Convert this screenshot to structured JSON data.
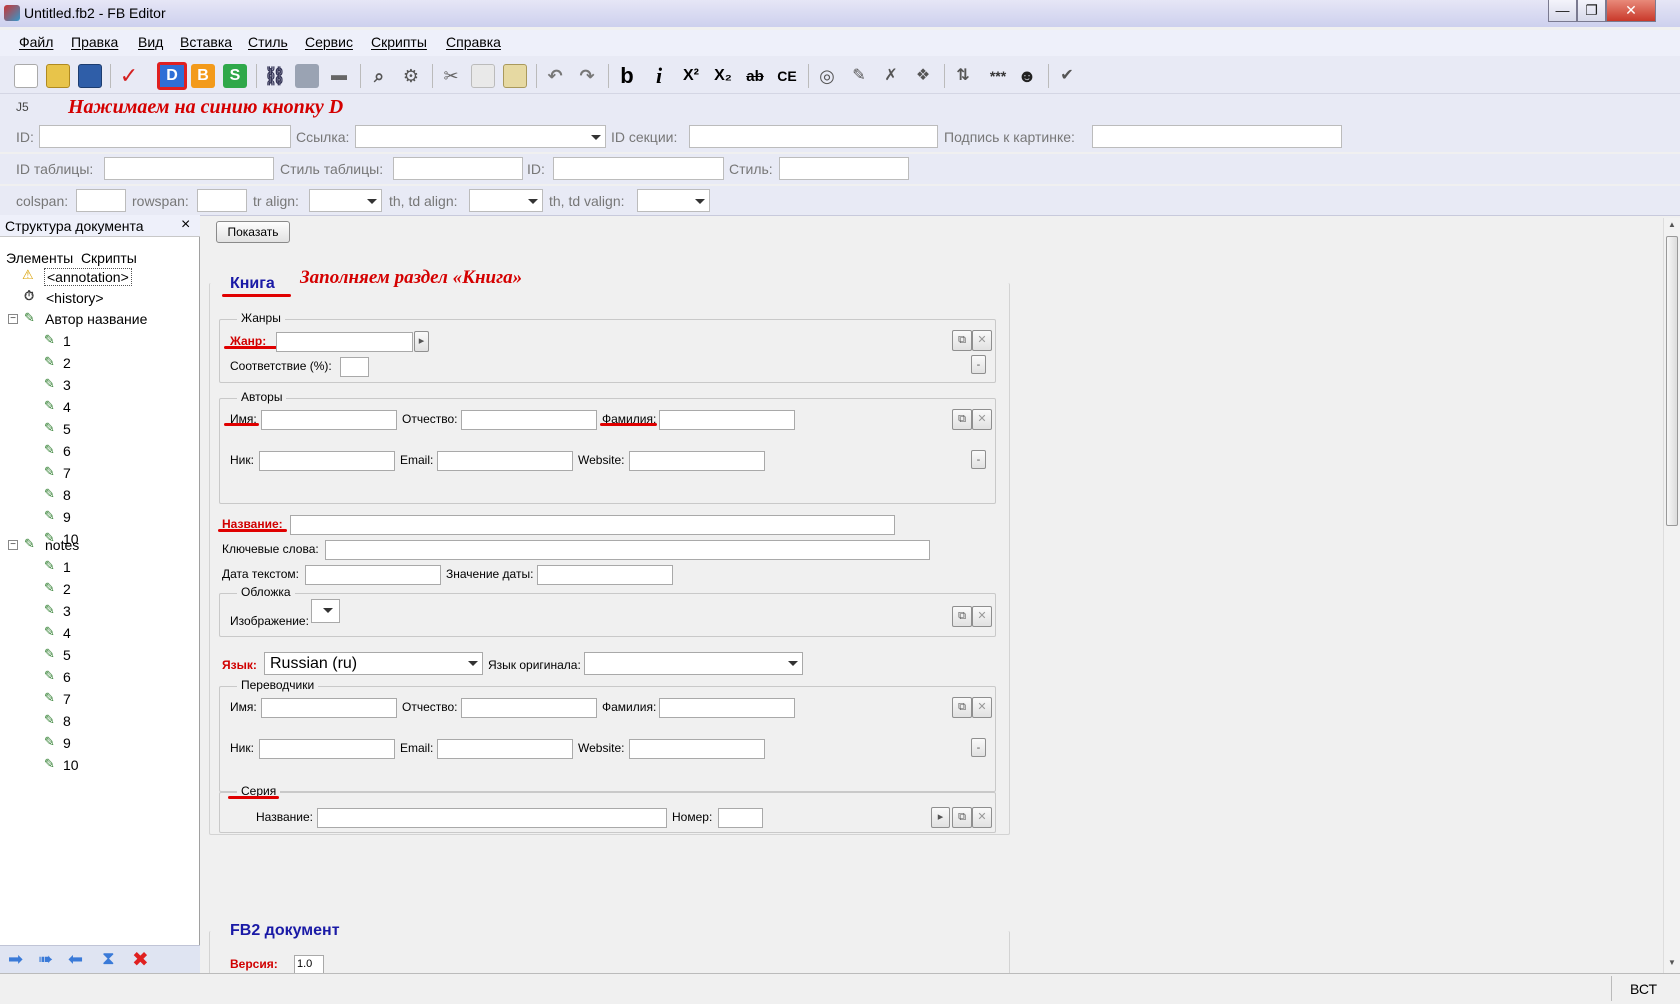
{
  "window": {
    "title": "Untitled.fb2 - FB Editor",
    "minimize": "—",
    "maximize": "❐",
    "close": "✕"
  },
  "menu": [
    "Файл",
    "Правка",
    "Вид",
    "Вставка",
    "Стиль",
    "Сервис",
    "Скрипты",
    "Справка"
  ],
  "toolbar": {
    "d_label": "D",
    "b_label": "B",
    "s_label": "S",
    "bold": "b",
    "italic": "i",
    "superscript": "X²",
    "subscript": "X₂",
    "strike": "ab",
    "code": "CE",
    "stars": "***"
  },
  "hint": {
    "top": "Нажимаем на синию кнопку D",
    "kniga": "Заполняем раздел «Книга»",
    "icon": "J5"
  },
  "props": {
    "row1": {
      "id": "ID:",
      "link": "Ссылка:",
      "section_id": "ID секции:",
      "caption": "Подпись к картинке:"
    },
    "row2": {
      "table_id": "ID таблицы:",
      "table_style": "Стиль таблицы:",
      "id": "ID:",
      "style": "Стиль:"
    },
    "row3": {
      "colspan": "colspan:",
      "rowspan": "rowspan:",
      "tr_align": "tr align:",
      "th_align": "th, td align:",
      "th_valign": "th, td valign:"
    }
  },
  "panel": {
    "title": "Структура документа",
    "close": "×",
    "tabs": "Элементы  Скрипты",
    "annotation": "<annotation>",
    "history": "<history>",
    "author_node": "Автор название",
    "notes_node": "notes",
    "children": [
      "1",
      "2",
      "3",
      "4",
      "5",
      "6",
      "7",
      "8",
      "9",
      "10"
    ]
  },
  "main": {
    "show_button": "Показать",
    "book_title": "Книга",
    "genres_legend": "Жанры",
    "genre_label": "Жанр:",
    "match_label": "Соответствие (%):",
    "authors_legend": "Авторы",
    "first_name": "Имя:",
    "middle_name": "Отчество:",
    "last_name": "Фамилия:",
    "nick": "Ник:",
    "email": "Email:",
    "website": "Website:",
    "title_label": "Название:",
    "keywords_label": "Ключевые слова:",
    "date_text_label": "Дата текстом:",
    "date_value_label": "Значение даты:",
    "cover_legend": "Обложка",
    "image_label": "Изображение:",
    "lang_label": "Язык:",
    "lang_value": "Russian (ru)",
    "src_lang_label": "Язык оригинала:",
    "translators_legend": "Переводчики",
    "series_legend": "Серия",
    "series_name": "Название:",
    "series_number": "Номер:",
    "fb2_title": "FB2 документ",
    "version_label": "Версия:",
    "version_value": "1.0"
  },
  "status": {
    "mode": "ВСТ"
  }
}
